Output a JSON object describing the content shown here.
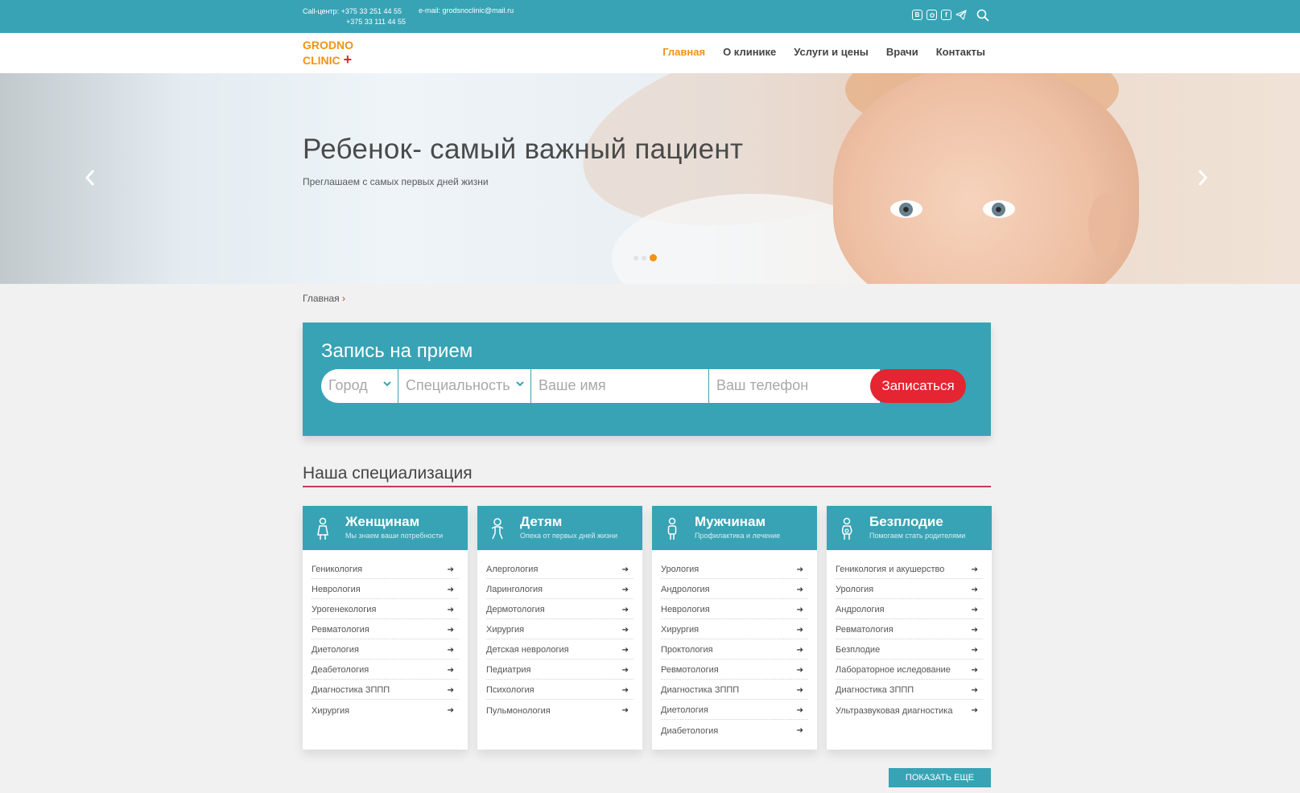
{
  "topbar": {
    "phone_label": "Call-центр: +375 33 251 44 55",
    "phone_2": "+375 33 111 44 55",
    "email": "e-mail: grodsnoclinic@mail.ru",
    "socials": [
      "vk-icon",
      "instagram-icon",
      "facebook-icon",
      "telegram-icon"
    ],
    "search_icon": "search-icon"
  },
  "header": {
    "logo_line1": "GRODNO",
    "logo_line2": "CLINIC",
    "logo_plus": "+",
    "nav": [
      "Главная",
      "О клинике",
      "Услуги и цены",
      "Врачи",
      "Контакты"
    ],
    "active_nav": "Главная"
  },
  "hero": {
    "title": "Ребенок- самый важный пациент",
    "subtitle": "Преглашаем с самых первых дней жизни",
    "prev": "‹",
    "next": "›",
    "slides_total": 3,
    "active_slide": 3
  },
  "breadcrumb": {
    "home": "Главная",
    "sep": "›"
  },
  "booking": {
    "title": "Запись на прием",
    "city_placeholder": "Город",
    "specialty_placeholder": "Специальность",
    "name_placeholder": "Ваше имя",
    "phone_placeholder": "Ваш телефон",
    "submit": "Записаться"
  },
  "specialization": {
    "title": "Наша специализация",
    "cards": [
      {
        "title": "Женщинам",
        "subtitle": "Мы знаем ваши потребности",
        "icon": "woman-icon",
        "items": [
          "Геникология",
          "Неврология",
          "Урогенекология",
          "Ревматология",
          "Диетология",
          "Деабетология",
          "Диагностика ЗППП",
          "Хирургия"
        ]
      },
      {
        "title": "Детям",
        "subtitle": "Опека от первых дней жизни",
        "icon": "child-icon",
        "items": [
          "Алергология",
          "Ларингология",
          "Дермотология",
          "Хирургия",
          "Детская неврология",
          "Педиатрия",
          "Психология",
          "Пульмонология"
        ]
      },
      {
        "title": "Мужчинам",
        "subtitle": "Профилактика и лечение",
        "icon": "man-icon",
        "items": [
          "Урология",
          "Андрология",
          "Неврология",
          "Хирургия",
          "Проктология",
          "Ревмотология",
          "Диагностика ЗППП",
          "Диетология",
          "Диабетология"
        ]
      },
      {
        "title": "Безплодие",
        "subtitle": "Помогаем стать родителями",
        "icon": "pregnant-icon",
        "items": [
          "Геникология и акушерство",
          "Урология",
          "Андрология",
          "Ревматология",
          "Безплодие",
          "Лабораторное иследование",
          "Диагностика ЗППП",
          "Ультразвуковая диагностика"
        ]
      }
    ],
    "more_button": "ПОКАЗАТЬ ЕЩЕ"
  },
  "colors": {
    "teal": "#38a3b5",
    "orange": "#f39214",
    "red": "#e52531",
    "background": "#f1f1f1"
  }
}
